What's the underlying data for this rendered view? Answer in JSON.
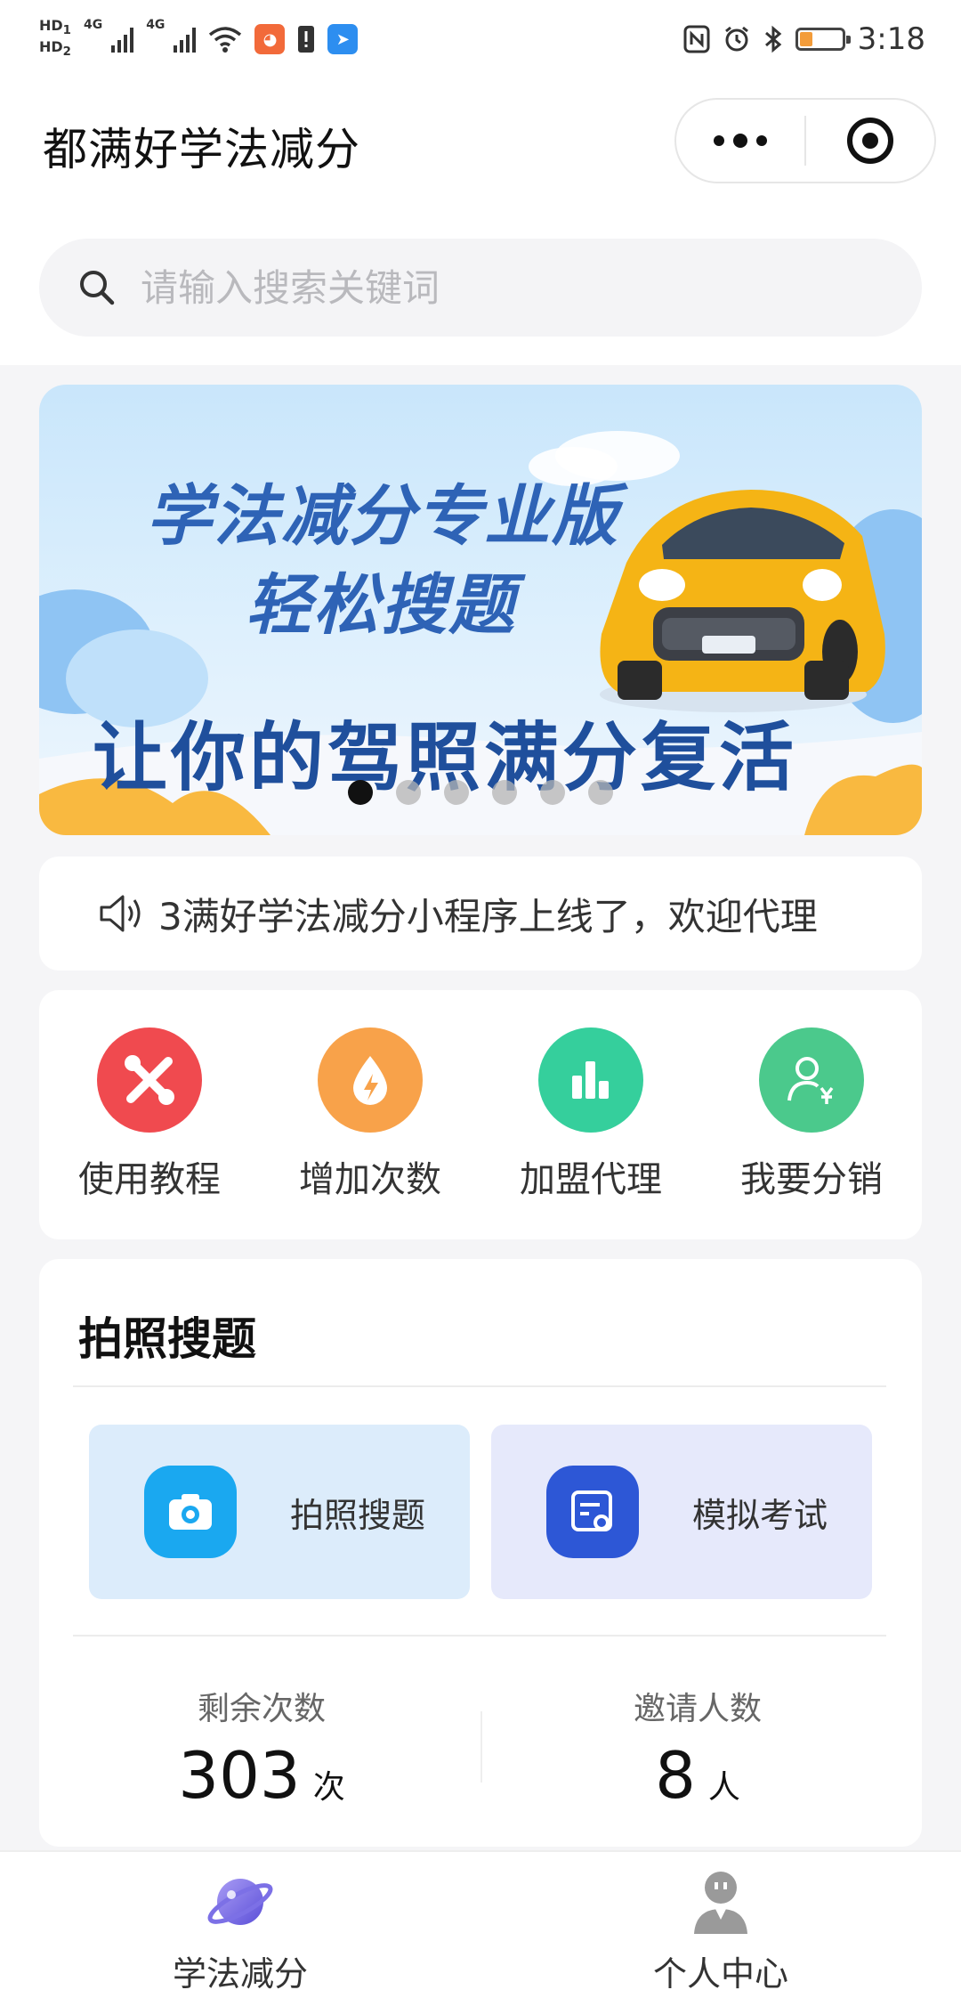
{
  "status_bar": {
    "hd1": "HD",
    "hd1_sub": "1",
    "hd2": "HD",
    "hd2_sub": "2",
    "net1": "4G",
    "net2": "4G",
    "time": "3:18"
  },
  "header": {
    "title": "都满好学法减分"
  },
  "search": {
    "placeholder": "请输入搜索关键词"
  },
  "banner": {
    "line1": "学法减分专业版",
    "line2": "轻松搜题",
    "line3": "让你的驾照满分复活",
    "dots_total": 6,
    "active_dot": 1
  },
  "notice": {
    "text": "3满好学法减分小程序上线了，欢迎代理"
  },
  "quick_menu": [
    {
      "label": "使用教程",
      "icon": "tools-icon",
      "color": "#f04a4f"
    },
    {
      "label": "增加次数",
      "icon": "energy-drop-icon",
      "color": "#f8a24a"
    },
    {
      "label": "加盟代理",
      "icon": "bar-chart-icon",
      "color": "#35cf9c"
    },
    {
      "label": "我要分销",
      "icon": "user-yuan-icon",
      "color": "#4bc98c"
    }
  ],
  "photo_card": {
    "title": "拍照搜题",
    "tiles": [
      {
        "label": "拍照搜题",
        "icon": "camera-icon",
        "color": "#1aa8f0"
      },
      {
        "label": "模拟考试",
        "icon": "exam-icon",
        "color": "#2d57d6"
      }
    ],
    "stats": [
      {
        "label": "剩余次数",
        "value": "303",
        "unit": "次"
      },
      {
        "label": "邀请人数",
        "value": "8",
        "unit": "人"
      }
    ]
  },
  "tabbar": [
    {
      "label": "学法减分",
      "icon": "planet-icon",
      "active": true
    },
    {
      "label": "个人中心",
      "icon": "person-icon",
      "active": false
    }
  ]
}
